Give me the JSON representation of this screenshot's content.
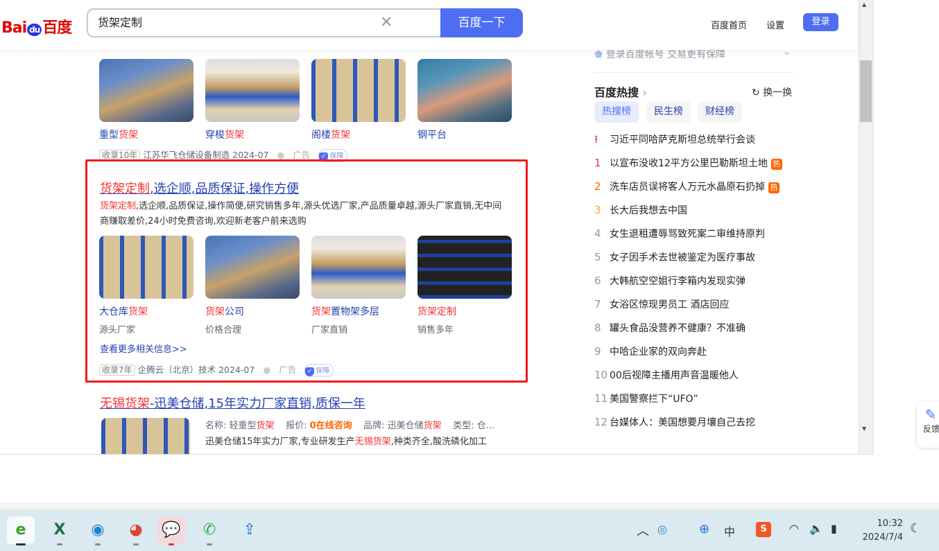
{
  "header": {
    "logo": "Bai百度",
    "logo_du": "du",
    "query": "货架定制",
    "search_button": "百度一下",
    "links": [
      "百度首页",
      "设置"
    ],
    "login": "登录"
  },
  "result1": {
    "items": [
      {
        "a": "重型",
        "b": "货架"
      },
      {
        "a": "穿梭",
        "b": "货架"
      },
      {
        "a": "阁楼",
        "b": "货架"
      },
      {
        "a": "钢平台",
        "b": ""
      }
    ],
    "tag": "收录10年",
    "source": "江苏华飞仓储设备制造 2024-07",
    "ad": "广告",
    "bao": "保障"
  },
  "result2": {
    "title_red": "货架定制",
    "title_rest": ",选企顺,品质保证,操作方便",
    "desc_red": "货架定制",
    "desc_rest": ",选企顺,品质保证,操作简便,研究销售多年,源头优选厂家,产品质量卓越,源头厂家直销,无中间商赚取差价,24小时免费咨询,欢迎新老客户前来选购",
    "items": [
      {
        "pre": "大仓库",
        "red": "货架",
        "post": "",
        "sub": "源头厂家"
      },
      {
        "pre": "",
        "red": "货架",
        "post": "公司",
        "sub": "价格合理"
      },
      {
        "pre": "",
        "red": "货架",
        "post": "置物架多层",
        "sub": "厂家直销"
      },
      {
        "pre": "",
        "red": "货架定制",
        "post": "",
        "sub": "销售多年"
      }
    ],
    "more": "查看更多相关信息>>",
    "tag": "收录7年",
    "source": "企腾云（北京）技术 2024-07",
    "ad": "广告",
    "bao": "保障"
  },
  "result3": {
    "title_red": "无锡货架",
    "title_rest": "-迅美仓储,15年实力厂家直销,质保一年",
    "l1": "名称: 轻重型",
    "l1r": "货架",
    "l2": "报价: ",
    "l2o": "0在线咨询",
    "l3": "品牌: 迅美仓储",
    "l3r": "货架",
    "l4": "类型: 仓...",
    "line2a": "迅美仓储15年实力厂家,专业研发生产",
    "line2r": "无锡货架",
    "line2b": ",种类齐全,酸洗磷化加工"
  },
  "sidebar": {
    "login_tip": "登录百度帐号 交易更有保障",
    "hot_title": "百度热搜",
    "refresh": "换一换",
    "tabs": [
      "热搜榜",
      "民生榜",
      "财经榜"
    ],
    "hot": [
      {
        "n": "",
        "t": "习近平同哈萨克斯坦总统举行会谈",
        "badge": ""
      },
      {
        "n": "1",
        "t": "以宣布没收12平方公里巴勒斯坦土地",
        "badge": "热"
      },
      {
        "n": "2",
        "t": "洗车店员误将客人万元水晶原石扔掉",
        "badge": "热"
      },
      {
        "n": "3",
        "t": "长大后我想去中国",
        "badge": ""
      },
      {
        "n": "4",
        "t": "女生退租遭辱骂致死案二审维持原判",
        "badge": ""
      },
      {
        "n": "5",
        "t": "女子因手术去世被鉴定为医疗事故",
        "badge": ""
      },
      {
        "n": "6",
        "t": "大韩航空空姐行李箱内发现实弹",
        "badge": ""
      },
      {
        "n": "7",
        "t": "女浴区惊现男员工 酒店回应",
        "badge": ""
      },
      {
        "n": "8",
        "t": "罐头食品没营养不健康？不准确",
        "badge": ""
      },
      {
        "n": "9",
        "t": "中哈企业家的双向奔赴",
        "badge": ""
      },
      {
        "n": "10",
        "t": "00后视障主播用声音温暖他人",
        "badge": ""
      },
      {
        "n": "11",
        "t": "美国警察拦下“UFO”",
        "badge": ""
      },
      {
        "n": "12",
        "t": "台媒体人：美国想要月壤自己去挖",
        "badge": ""
      }
    ]
  },
  "feedback": "反馈",
  "taskbar": {
    "time": "10:32",
    "date": "2024/7/4",
    "ime": "中",
    "sogou": "S"
  },
  "colors": {
    "accent": "#4e6ef2",
    "red": "#f73131",
    "link": "#2440b3",
    "box": "#f11a1a"
  }
}
